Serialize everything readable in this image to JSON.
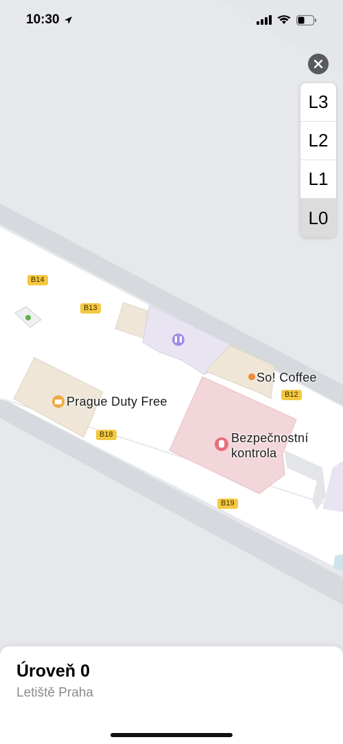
{
  "status_bar": {
    "time": "10:30",
    "icons": [
      "location-arrow-icon",
      "cellular-signal-icon",
      "wifi-icon",
      "battery-icon"
    ]
  },
  "map": {
    "close_icon": "close-icon",
    "levels": [
      "L3",
      "L2",
      "L1",
      "L0"
    ],
    "selected_level": "L0",
    "gates": [
      "B14",
      "B13",
      "B12",
      "B18",
      "B19"
    ],
    "places": {
      "duty_free": "Prague Duty Free",
      "coffee": "So! Coffee",
      "security_line1": "Bezpečnostní",
      "security_line2": "kontrola"
    },
    "colors": {
      "corridor": "#ffffff",
      "walls": "#d6d9de",
      "shop": "#efe6d8",
      "restroom": "#e9e4f1",
      "security": "#f3d6da",
      "gate_badge": "#f5c842",
      "shopping_pin": "#f0a940",
      "security_pin": "#e8707e",
      "coffee_dot": "#f08a3c"
    }
  },
  "sheet": {
    "title": "Úroveň 0",
    "subtitle": "Letiště Praha"
  }
}
